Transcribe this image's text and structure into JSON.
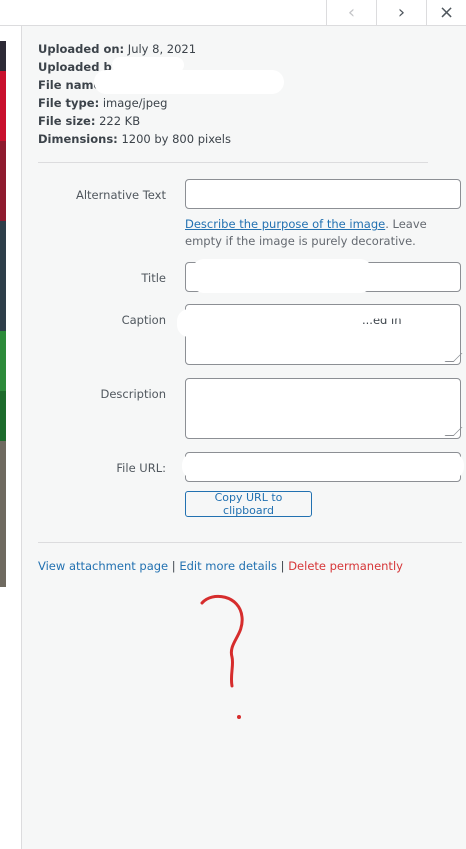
{
  "header": {
    "prev_label": "‹",
    "next_label": "›",
    "close_label": "×"
  },
  "details": {
    "uploaded_on_label": "Uploaded on:",
    "uploaded_on_value": "July 8, 2021",
    "uploaded_by_label": "Uploaded by:",
    "file_name_label": "File name",
    "file_type_label": "File type:",
    "file_type_value": "image/jpeg",
    "file_size_label": "File size:",
    "file_size_value": "222 KB",
    "dimensions_label": "Dimensions:",
    "dimensions_value": "1200 by 800 pixels"
  },
  "form": {
    "alt_text_label": "Alternative Text",
    "alt_help_link": "Describe the purpose of the image",
    "alt_help_rest": ". Leave empty if the image is purely decorative.",
    "title_label": "Title",
    "caption_label": "Caption",
    "caption_visible_fragment": "...ed in",
    "description_label": "Description",
    "file_url_label": "File URL:",
    "copy_button": "Copy URL to clipboard"
  },
  "actions": {
    "view_attachment": "View attachment page",
    "separator": " | ",
    "edit_details": "Edit more details",
    "delete": "Delete permanently"
  },
  "colors": {
    "link": "#2271b1",
    "delete": "#d63638",
    "annotation": "#d62d2d"
  }
}
